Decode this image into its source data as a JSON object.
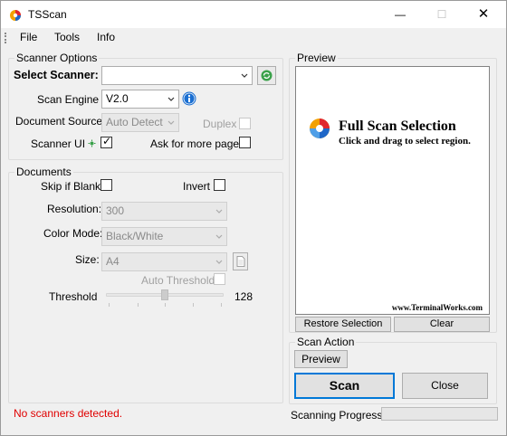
{
  "window": {
    "title": "TSScan",
    "min_glyph": "—",
    "max_glyph": "☐",
    "close_glyph": "✕"
  },
  "menu": [
    "File",
    "Tools",
    "Info"
  ],
  "scanner_options": {
    "legend": "Scanner Options",
    "select_scanner_label": "Select Scanner:",
    "select_scanner_value": "",
    "scan_engine_label": "Scan Engine",
    "scan_engine_value": "V2.0",
    "document_source_label": "Document Source:",
    "document_source_value": "Auto Detect",
    "duplex_label": "Duplex",
    "duplex_checked": false,
    "scanner_ui_label": "Scanner UI",
    "scanner_ui_checked": true,
    "ask_more_pages_label": "Ask for more pages",
    "ask_more_pages_checked": false
  },
  "documents": {
    "legend": "Documents",
    "skip_blank_label": "Skip if Blank",
    "skip_blank_checked": false,
    "invert_label": "Invert",
    "invert_checked": false,
    "resolution_label": "Resolution:",
    "resolution_value": "300",
    "color_mode_label": "Color Mode:",
    "color_mode_value": "Black/White",
    "size_label": "Size:",
    "size_value": "A4",
    "auto_threshold_label": "Auto Threshold",
    "auto_threshold_checked": false,
    "threshold_label": "Threshold",
    "threshold_value": "128",
    "threshold_fraction": 0.5
  },
  "status_text": "No scanners detected.",
  "preview": {
    "legend": "Preview",
    "logo_title": "Full Scan Selection",
    "logo_subtitle": "Click and drag to select region.",
    "url": "www.TerminalWorks.com",
    "restore_label": "Restore Selection",
    "clear_label": "Clear"
  },
  "scan_action": {
    "legend": "Scan Action",
    "preview_label": "Preview",
    "scan_label": "Scan",
    "close_label": "Close",
    "progress_label": "Scanning Progress",
    "progress_fraction": 0
  },
  "colors": {
    "error": "#e00000",
    "focus": "#0078d7",
    "refresh_green": "#3aa14a",
    "info_blue": "#1b6fd1"
  }
}
